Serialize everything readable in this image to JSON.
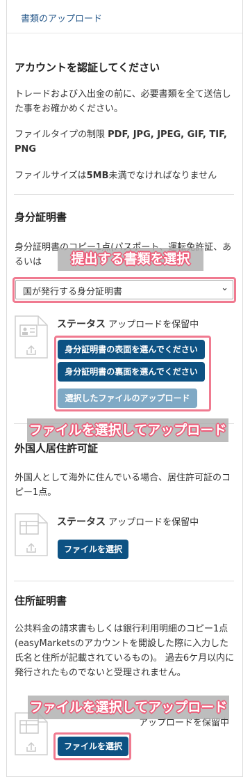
{
  "header": {
    "title": "書類のアップロード"
  },
  "intro": {
    "heading": "アカウントを認証してください",
    "text": "トレードおよび入出金の前に、必要書類を全て送信した事をお確かめください。",
    "filetype_prefix": "ファイルタイプの制限 ",
    "filetype_values": "PDF, JPG, JPEG, GIF, TIF, PNG",
    "filesize_prefix": "ファイルサイズは",
    "filesize_value": "5MB",
    "filesize_suffix": "未満でなければなりません"
  },
  "identity": {
    "heading": "身分証明書",
    "text": "身分証明書のコピー1点(パスポート、運転免許証、あるいは",
    "select_value": "国が発行する身分証明書",
    "status_label": "ステータス",
    "status_value": "アップロードを保留中",
    "front_button": "身分証明書の表面を選んでください",
    "back_button": "身分証明書の裏面を選んでください",
    "upload_button": "選択したファイルのアップロード"
  },
  "residence": {
    "heading": "外国人居住許可証",
    "text": "外国人として海外に住んでいる場合、居住許可証のコピー1点。",
    "status_label": "ステータス",
    "status_value": "アップロードを保留中",
    "choose_button": "ファイルを選択"
  },
  "address": {
    "heading": "住所証明書",
    "text": "公共料金の請求書もしくは銀行利用明細のコピー1点(easyMarketsのアカウントを開設した際に入力した氏名と住所が記載されているもの)。 過去6ケ月以内に発行されたものでないと受理されません。",
    "status_value": "アップロードを保留中",
    "choose_button": "ファイルを選択"
  },
  "annotations": {
    "select_doc": "提出する書類を選択",
    "select_upload_1": "ファイルを選択してアップロード",
    "select_upload_2": "ファイルを選択してアップロード"
  },
  "colors": {
    "button": "#0d5283",
    "button_disabled": "#7fa9c5",
    "highlight": "#f07a90",
    "link": "#2a5b8c"
  }
}
